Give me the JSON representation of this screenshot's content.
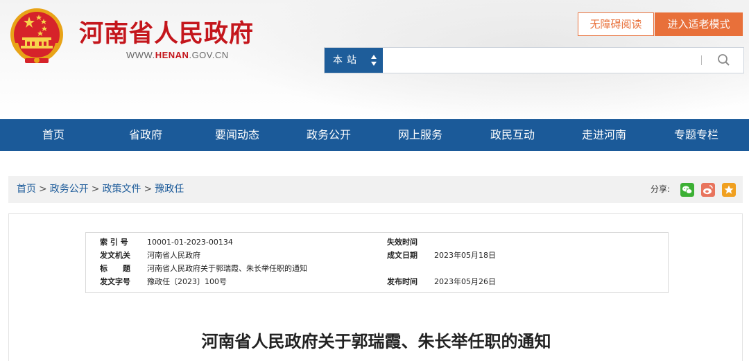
{
  "header": {
    "site_title": "河南省人民政府",
    "site_url_prefix": "WWW.",
    "site_url_domain": "HENAN",
    "site_url_suffix": ".GOV.CN",
    "accessible_read_label": "无障碍阅读",
    "elder_mode_label": "进入适老模式",
    "search": {
      "scope_label": "本站",
      "placeholder": "",
      "value": ""
    },
    "colors": {
      "title_red": "#c4161c",
      "accent_orange": "#e8703a",
      "nav_blue": "#1b5a99"
    }
  },
  "nav": {
    "items": [
      "首页",
      "省政府",
      "要闻动态",
      "政务公开",
      "网上服务",
      "政民互动",
      "走进河南",
      "专题专栏"
    ]
  },
  "breadcrumb": {
    "items": [
      "首页",
      "政务公开",
      "政策文件",
      "豫政任"
    ],
    "separator": ">"
  },
  "share": {
    "label": "分享:",
    "buttons": [
      {
        "icon": "wechat-icon",
        "color": "#3cb034"
      },
      {
        "icon": "weibo-icon",
        "color": "#e8745d"
      },
      {
        "icon": "star-favorite-icon",
        "color": "#f0a020"
      }
    ]
  },
  "meta": {
    "index_label": "索 引 号",
    "index_value": "10001-01-2023-00134",
    "issuer_label": "发文机关",
    "issuer_value": "河南省人民政府",
    "subject_label": "标　　题",
    "subject_value": "河南省人民政府关于郭瑞霞、朱长举任职的通知",
    "docno_label": "发文字号",
    "docno_value": "豫政任〔2023〕100号",
    "expiry_label": "失效时间",
    "expiry_value": "",
    "written_label": "成文日期",
    "written_value": "2023年05月18日",
    "published_label": "发布时间",
    "published_value": "2023年05月26日"
  },
  "article": {
    "title": "河南省人民政府关于郭瑞霞、朱长举任职的通知"
  }
}
